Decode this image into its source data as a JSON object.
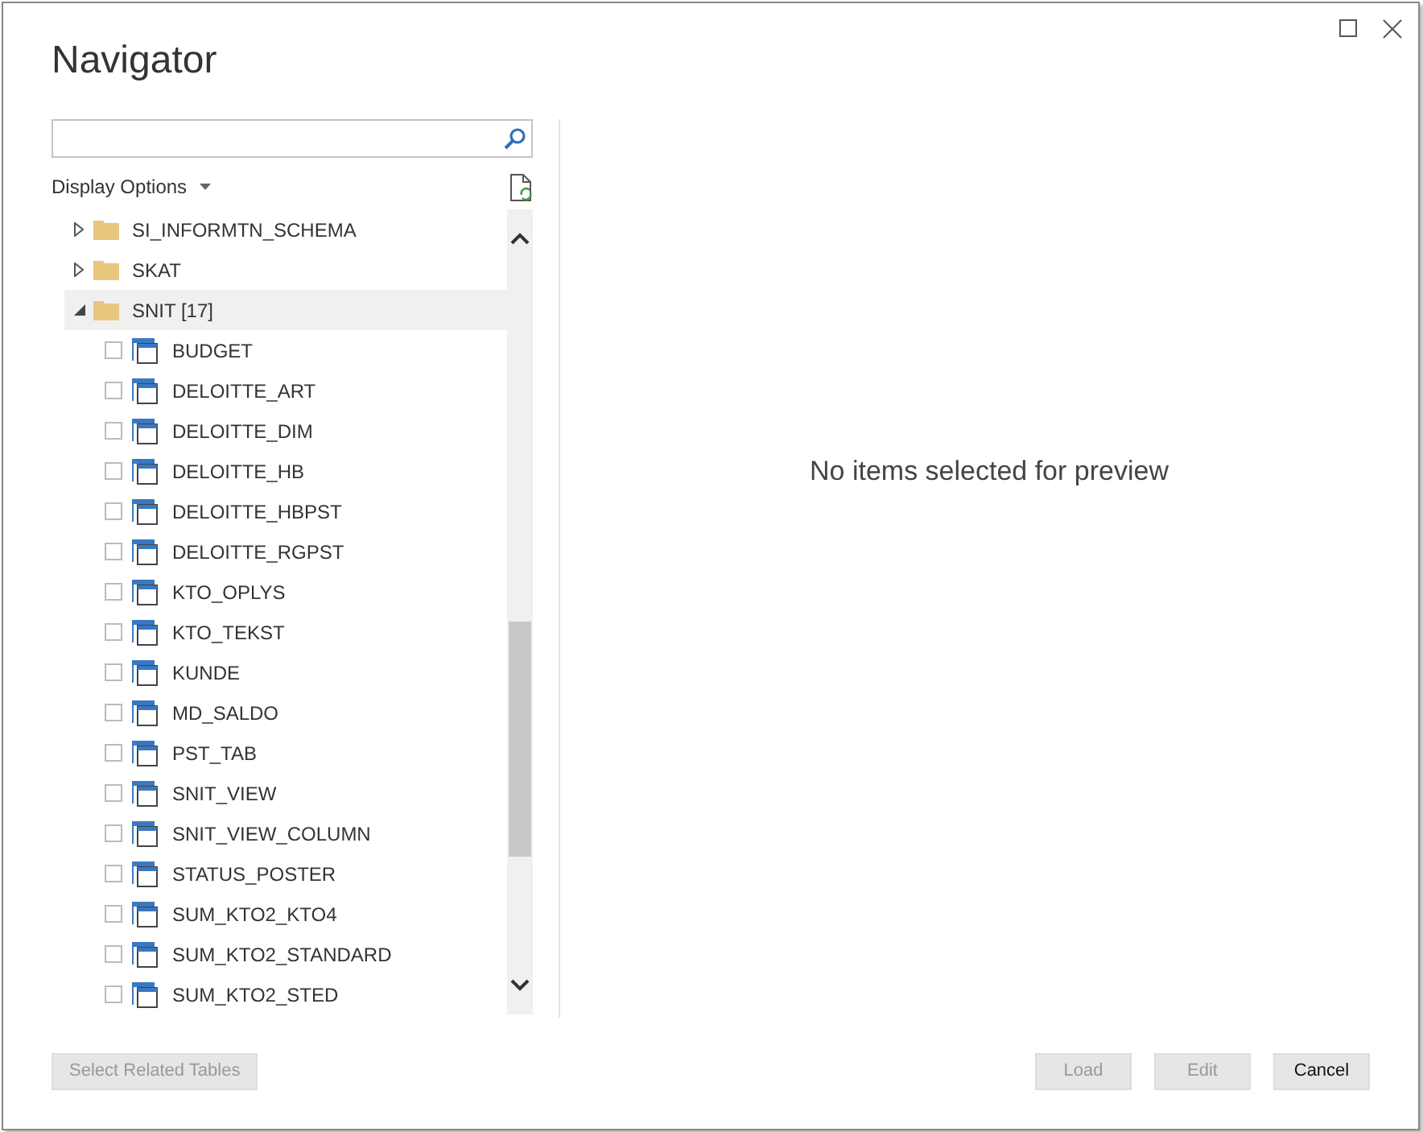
{
  "window": {
    "title": "Navigator"
  },
  "display_options": {
    "label": "Display Options"
  },
  "tree": {
    "items": [
      {
        "kind": "folder",
        "label": "SI_INFORMTN_SCHEMA",
        "expanded": false,
        "selected": false
      },
      {
        "kind": "folder",
        "label": "SKAT",
        "expanded": false,
        "selected": false
      },
      {
        "kind": "folder",
        "label": "SNIT [17]",
        "expanded": true,
        "selected": true,
        "children": [
          {
            "kind": "table",
            "label": "BUDGET",
            "checked": false
          },
          {
            "kind": "table",
            "label": "DELOITTE_ART",
            "checked": false
          },
          {
            "kind": "table",
            "label": "DELOITTE_DIM",
            "checked": false
          },
          {
            "kind": "table",
            "label": "DELOITTE_HB",
            "checked": false
          },
          {
            "kind": "table",
            "label": "DELOITTE_HBPST",
            "checked": false
          },
          {
            "kind": "table",
            "label": "DELOITTE_RGPST",
            "checked": false
          },
          {
            "kind": "table",
            "label": "KTO_OPLYS",
            "checked": false
          },
          {
            "kind": "table",
            "label": "KTO_TEKST",
            "checked": false
          },
          {
            "kind": "table",
            "label": "KUNDE",
            "checked": false
          },
          {
            "kind": "table",
            "label": "MD_SALDO",
            "checked": false
          },
          {
            "kind": "table",
            "label": "PST_TAB",
            "checked": false
          },
          {
            "kind": "table",
            "label": "SNIT_VIEW",
            "checked": false
          },
          {
            "kind": "table",
            "label": "SNIT_VIEW_COLUMN",
            "checked": false
          },
          {
            "kind": "table",
            "label": "STATUS_POSTER",
            "checked": false
          },
          {
            "kind": "table",
            "label": "SUM_KTO2_KTO4",
            "checked": false
          },
          {
            "kind": "table",
            "label": "SUM_KTO2_STANDARD",
            "checked": false
          },
          {
            "kind": "table",
            "label": "SUM_KTO2_STED",
            "checked": false
          }
        ]
      }
    ]
  },
  "preview": {
    "message": "No items selected for preview"
  },
  "left_buttons": [
    {
      "label": "Select Related Tables",
      "disabled": true
    }
  ],
  "buttons": [
    {
      "label": "Load",
      "disabled": true
    },
    {
      "label": "Edit",
      "disabled": true
    },
    {
      "label": "Cancel",
      "disabled": false
    }
  ]
}
